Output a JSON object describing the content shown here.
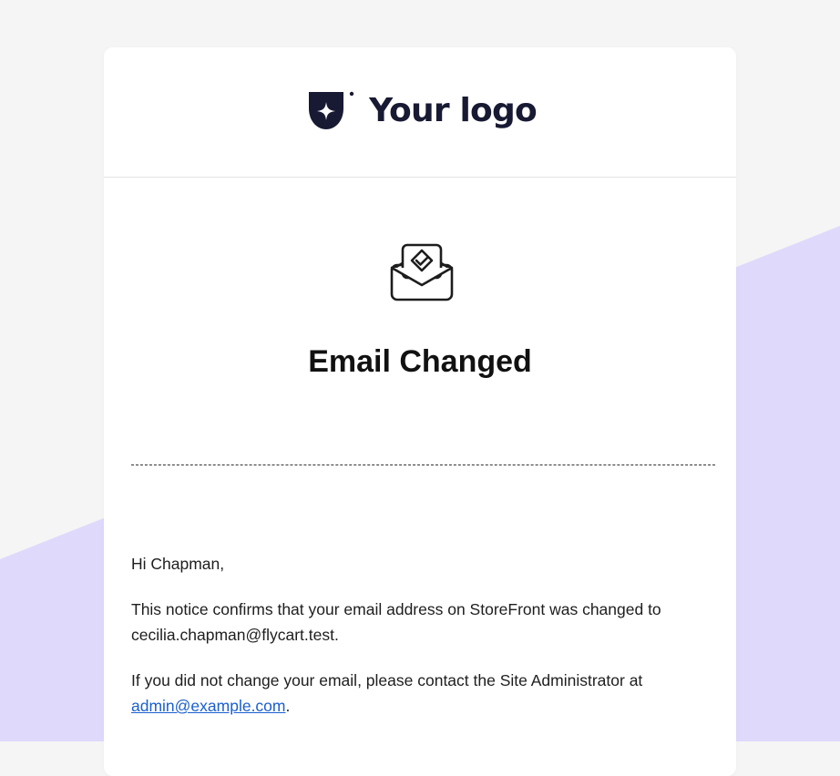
{
  "header": {
    "logo_text": "Your logo"
  },
  "hero": {
    "title": "Email Changed"
  },
  "message": {
    "greeting": "Hi Chapman,",
    "line1": "This notice confirms that your email address on StoreFront was changed to cecilia.chapman@flycart.test.",
    "line2_prefix": "If you did not change your email, please contact the Site Administrator at ",
    "admin_email": "admin@example.com",
    "line2_suffix": "."
  },
  "colors": {
    "page_background": "#f5f5f5",
    "accent_shape": "#dfd9fb",
    "logo_color": "#181a33",
    "link_color": "#1a5fd0"
  }
}
